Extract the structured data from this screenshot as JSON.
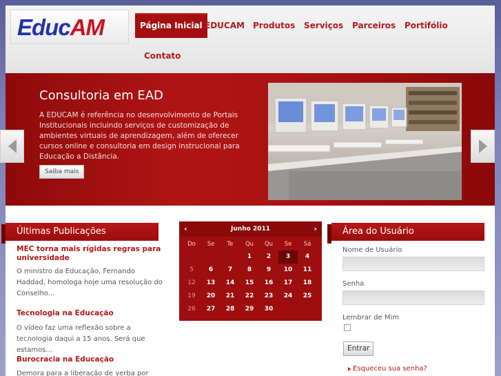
{
  "logo": {
    "part1": "Educ",
    "part2": "AM"
  },
  "nav": {
    "items": [
      "Página Inicial",
      "EDUCAM",
      "Produtos",
      "Serviços",
      "Parceiros",
      "Portifólio",
      "Contato"
    ],
    "active": "Página Inicial"
  },
  "banner": {
    "title": "Consultoria em EAD",
    "text": "A EDUCAM é referência no desenvolvimento de Portais Institucionais incluindo serviços de customização de ambientes virtuais de aprendizagem, além de oferecer cursos online e consultoria em design instrucional para Educação a Distância.",
    "button": "Saiba mais"
  },
  "publications": {
    "heading": "Últimas Publicações",
    "items": [
      {
        "title": "MEC torna mais rígidas regras para universidade",
        "text": "O ministro da Educação, Fernando Haddad, homologa hoje uma resolução do Conselho..."
      },
      {
        "title": "Tecnologia na Educação",
        "text": "O vídeo faz uma reflexão sobre a tecnologia daqui a 15 anos. Será que estamos..."
      },
      {
        "title": "Burocracia na Educação",
        "text": "Demora para a liberação de verba por parte"
      }
    ]
  },
  "calendar": {
    "month": "Junho 2011",
    "prev": "‹",
    "next": "›",
    "weekdays": [
      "Do",
      "Se",
      "Te",
      "Qu",
      "Qu",
      "Se",
      "Sá"
    ],
    "today": "3",
    "weeks": [
      [
        "",
        "",
        "",
        "1",
        "2",
        "3",
        "4"
      ],
      [
        "5",
        "6",
        "7",
        "8",
        "9",
        "10",
        "11"
      ],
      [
        "12",
        "13",
        "14",
        "15",
        "16",
        "17",
        "18"
      ],
      [
        "19",
        "20",
        "21",
        "22",
        "23",
        "24",
        "25"
      ],
      [
        "26",
        "27",
        "28",
        "29",
        "30",
        "",
        ""
      ]
    ]
  },
  "user_area": {
    "heading": "Área do Usuário",
    "username_label": "Nome de Usuário",
    "username_value": "",
    "password_label": "Senha",
    "password_value": "",
    "remember_label": "Lembrar de Mim",
    "remember_checked": false,
    "submit": "Entrar",
    "forgot": "Esqueceu sua senha?"
  },
  "colors": {
    "brand_red": "#a50f0f",
    "brand_blue": "#2233aa",
    "link_red": "#b11a1a"
  }
}
